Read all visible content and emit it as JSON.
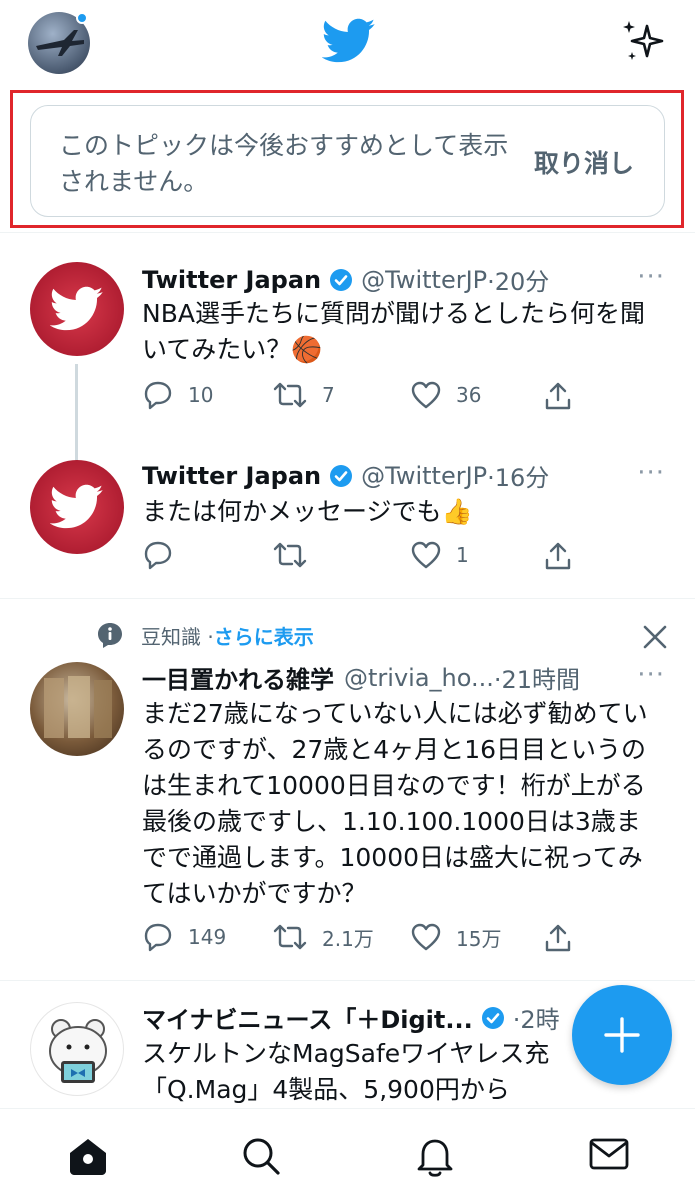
{
  "header": {
    "profile_icon": "profile-avatar",
    "logo_icon": "twitter-bird-icon",
    "sparkle_icon": "sparkle-icon",
    "accent": "#1d9bf0"
  },
  "undo_banner": {
    "text": "このトピックは今後おすすめとして表示されません。",
    "undo_label": "取り消し"
  },
  "tweets": [
    {
      "name": "Twitter Japan",
      "handle": "@TwitterJP",
      "time": "·20分",
      "text": "NBA選手たちに質問が聞けるとしたら何を聞いてみたい？🏀",
      "reply_count": "10",
      "retweet_count": "7",
      "like_count": "36"
    },
    {
      "name": "Twitter Japan",
      "handle": "@TwitterJP",
      "time": "·16分",
      "text": "または何かメッセージでも👍",
      "reply_count": "",
      "retweet_count": "",
      "like_count": "1"
    },
    {
      "topic_label": "豆知識 · ",
      "topic_more": "さらに表示",
      "name": "一目置かれる雑学",
      "handle": "@trivia_ho...",
      "time": "·21時間",
      "text": "まだ27歳になっていない人には必ず勧めているのですが、27歳と4ヶ月と16日目というのは生まれて10000日目なのです！桁が上がる最後の歳ですし、1.10.100.1000日は3歳までで通過します。10000日は盛大に祝ってみてはいかがですか？",
      "reply_count": "149",
      "retweet_count": "2.1万",
      "like_count": "15万"
    },
    {
      "name": "マイナビニュース「＋Digit...",
      "time": "·2時",
      "text": "スケルトンなMagSafeワイヤレス充「Q.Mag」4製品、5,900円から"
    }
  ],
  "more_label": "···",
  "nav": {
    "home_icon": "home-icon",
    "search_icon": "search-icon",
    "notifications_icon": "bell-icon",
    "messages_icon": "mail-icon"
  }
}
